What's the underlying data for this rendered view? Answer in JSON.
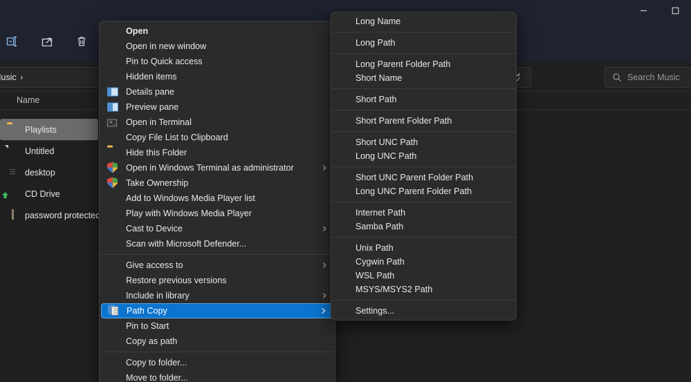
{
  "window": {
    "title_bar": {
      "minimize_label": "Minimize",
      "maximize_label": "Maximize"
    },
    "toolbar": [
      {
        "name": "rename-button",
        "icon": "rename-icon"
      },
      {
        "name": "share-button",
        "icon": "share-icon"
      },
      {
        "name": "delete-button",
        "icon": "trash-icon"
      }
    ],
    "address": {
      "crumb": "Music",
      "separator": "›",
      "dropdown_icon": "chevron-down-icon",
      "refresh_icon": "refresh-icon"
    },
    "search": {
      "placeholder": "Search Music",
      "icon": "search-icon"
    },
    "columns": {
      "name": "Name"
    },
    "files": [
      {
        "label": "Playlists",
        "icon": "folder-icon",
        "selected": true
      },
      {
        "label": "Untitled",
        "icon": "document-icon",
        "selected": false
      },
      {
        "label": "desktop",
        "icon": "config-icon",
        "selected": false
      },
      {
        "label": "CD Drive",
        "icon": "cd-drive-icon",
        "selected": false
      },
      {
        "label": "password protected.",
        "icon": "archive-icon",
        "selected": false
      }
    ]
  },
  "context_menu": {
    "groups": [
      {
        "items": [
          {
            "label": "Open",
            "icon": null,
            "bold": true,
            "submenu": false
          },
          {
            "label": "Open in new window",
            "icon": null,
            "bold": false,
            "submenu": false
          },
          {
            "label": "Pin to Quick access",
            "icon": null,
            "bold": false,
            "submenu": false
          },
          {
            "label": "Hidden items",
            "icon": null,
            "bold": false,
            "submenu": false
          },
          {
            "label": "Details pane",
            "icon": "details-pane-icon",
            "bold": false,
            "submenu": false
          },
          {
            "label": "Preview pane",
            "icon": "preview-pane-icon",
            "bold": false,
            "submenu": false
          },
          {
            "label": "Open in Terminal",
            "icon": "terminal-icon",
            "bold": false,
            "submenu": false
          },
          {
            "label": "Copy File List to Clipboard",
            "icon": null,
            "bold": false,
            "submenu": false
          },
          {
            "label": "Hide this Folder",
            "icon": "folder-icon",
            "bold": false,
            "submenu": false
          },
          {
            "label": "Open in Windows Terminal as administrator",
            "icon": "uac-shield-icon",
            "bold": false,
            "submenu": true
          },
          {
            "label": "Take Ownership",
            "icon": "uac-shield-icon",
            "bold": false,
            "submenu": false
          },
          {
            "label": "Add to Windows Media Player list",
            "icon": null,
            "bold": false,
            "submenu": false
          },
          {
            "label": "Play with Windows Media Player",
            "icon": null,
            "bold": false,
            "submenu": false
          },
          {
            "label": "Cast to Device",
            "icon": null,
            "bold": false,
            "submenu": true
          },
          {
            "label": "Scan with Microsoft Defender...",
            "icon": "defender-shield-icon",
            "bold": false,
            "submenu": false
          }
        ]
      },
      {
        "items": [
          {
            "label": "Give access to",
            "icon": null,
            "bold": false,
            "submenu": true
          },
          {
            "label": "Restore previous versions",
            "icon": null,
            "bold": false,
            "submenu": false
          },
          {
            "label": "Include in library",
            "icon": null,
            "bold": false,
            "submenu": true
          },
          {
            "label": "Path Copy",
            "icon": "path-copy-icon",
            "bold": false,
            "submenu": true,
            "highlighted": true
          },
          {
            "label": "Pin to Start",
            "icon": null,
            "bold": false,
            "submenu": false
          },
          {
            "label": "Copy as path",
            "icon": null,
            "bold": false,
            "submenu": false
          }
        ]
      },
      {
        "items": [
          {
            "label": "Copy to folder...",
            "icon": null,
            "bold": false,
            "submenu": false
          },
          {
            "label": "Move to folder...",
            "icon": null,
            "bold": false,
            "submenu": false
          }
        ]
      }
    ]
  },
  "submenu": {
    "groups": [
      {
        "items": [
          {
            "label": "Long Name"
          }
        ]
      },
      {
        "items": [
          {
            "label": "Long Path"
          }
        ]
      },
      {
        "items": [
          {
            "label": "Long Parent Folder Path"
          },
          {
            "label": "Short Name"
          }
        ]
      },
      {
        "items": [
          {
            "label": "Short Path"
          }
        ]
      },
      {
        "items": [
          {
            "label": "Short Parent Folder Path"
          }
        ]
      },
      {
        "items": [
          {
            "label": "Short UNC Path"
          },
          {
            "label": "Long UNC Path"
          }
        ]
      },
      {
        "items": [
          {
            "label": "Short UNC Parent Folder Path"
          },
          {
            "label": "Long UNC Parent Folder Path"
          }
        ]
      },
      {
        "items": [
          {
            "label": "Internet Path"
          },
          {
            "label": "Samba Path"
          }
        ]
      },
      {
        "items": [
          {
            "label": "Unix Path"
          },
          {
            "label": "Cygwin Path"
          },
          {
            "label": "WSL Path"
          },
          {
            "label": "MSYS/MSYS2 Path"
          }
        ]
      },
      {
        "items": [
          {
            "label": "Settings..."
          }
        ]
      }
    ]
  },
  "colors": {
    "menu_bg": "#2b2b2b",
    "menu_border": "#3c3c3c",
    "highlight": "#0b74cf",
    "highlight_border": "#5fa6e0",
    "window_bg": "#202020",
    "titlebar_bg": "#1f2330",
    "text": "#e9e9e9",
    "selected_row": "#6b6b6b",
    "folder_yellow": "#e9b454"
  }
}
